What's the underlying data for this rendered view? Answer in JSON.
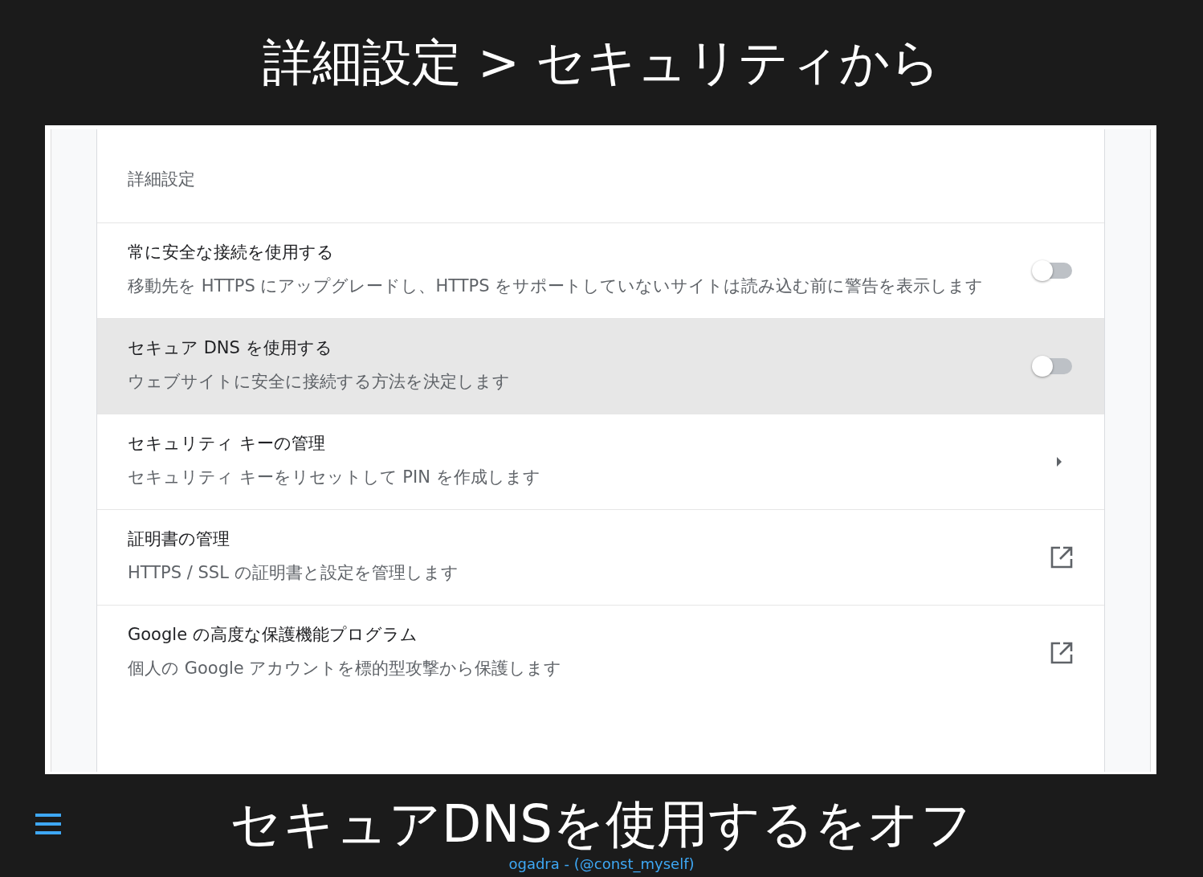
{
  "slide_title": "詳細設定 > セキュリティから",
  "settings": {
    "section_title": "詳細設定",
    "rows": [
      {
        "kind": "toggle",
        "title": "常に安全な接続を使用する",
        "description": "移動先を HTTPS にアップグレードし、HTTPS をサポートしていないサイトは読み込む前に警告を表示します",
        "on": false,
        "highlighted": false
      },
      {
        "kind": "toggle",
        "title": "セキュア DNS を使用する",
        "description": "ウェブサイトに安全に接続する方法を決定します",
        "on": false,
        "highlighted": true
      },
      {
        "kind": "arrow",
        "title": "セキュリティ キーの管理",
        "description": "セキュリティ キーをリセットして PIN を作成します",
        "highlighted": false
      },
      {
        "kind": "external",
        "title": "証明書の管理",
        "description": "HTTPS / SSL の証明書と設定を管理します",
        "highlighted": false
      },
      {
        "kind": "external",
        "title": "Google の高度な保護機能プログラム",
        "description": "個人の Google アカウントを標的型攻撃から保護します",
        "highlighted": false
      }
    ]
  },
  "caption": "セキュアDNSを使用するをオフ",
  "footer": "ogadra - (@const_myself)"
}
